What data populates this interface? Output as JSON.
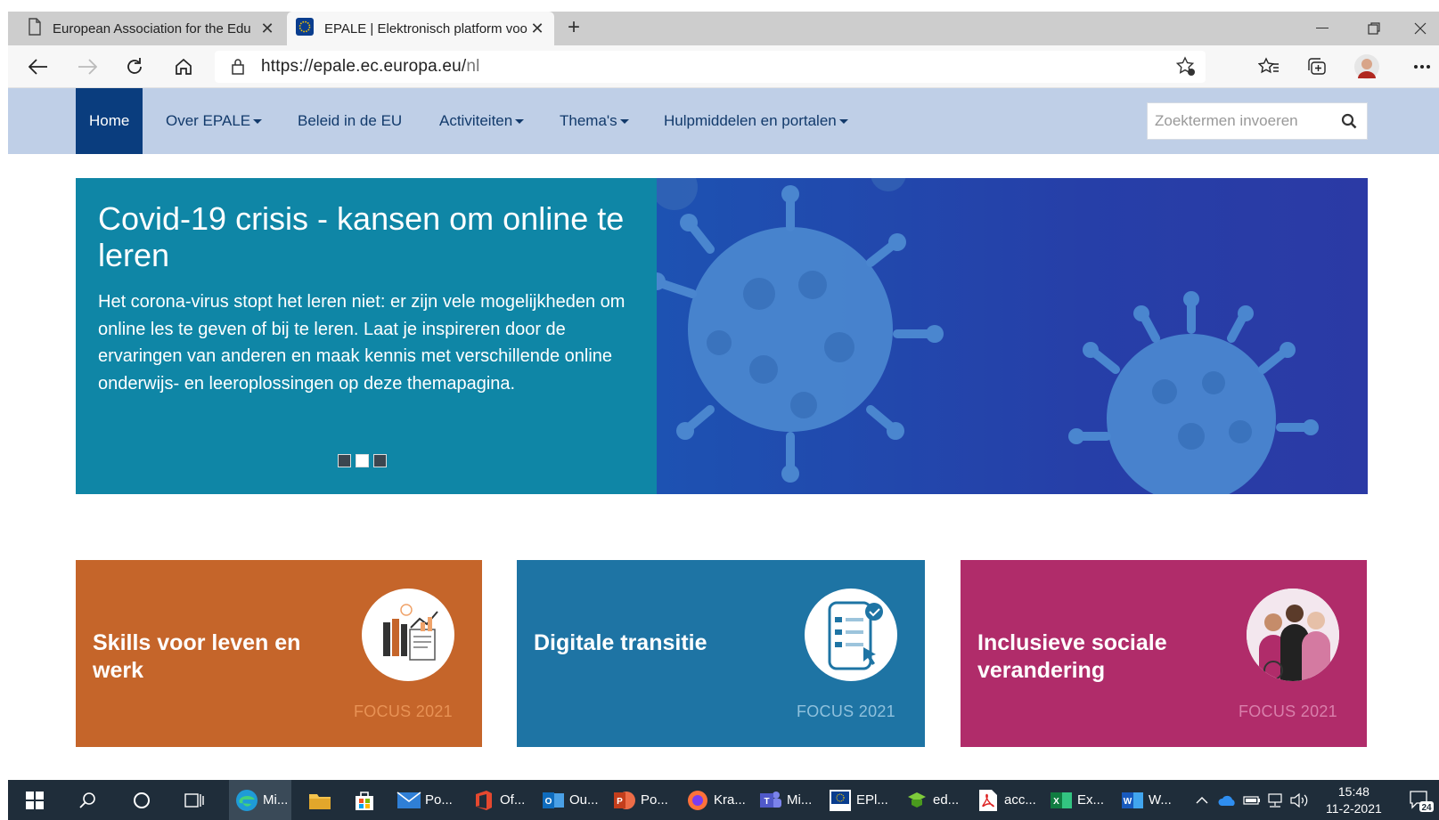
{
  "browser": {
    "tabs": [
      {
        "title": "European Association for the Edu",
        "close": "✕"
      },
      {
        "title": "EPALE | Elektronisch platform voo",
        "close": "✕"
      }
    ],
    "new_tab": "+",
    "url_host": "https://epale.ec.europa.eu/",
    "url_path": "nl",
    "window_controls": [
      "minimize",
      "restore",
      "close"
    ]
  },
  "site_nav": {
    "items": [
      "Home",
      "Over EPALE",
      "Beleid in de EU",
      "Activiteiten",
      "Thema's",
      "Hulpmiddelen en portalen"
    ],
    "search_placeholder": "Zoektermen invoeren"
  },
  "hero": {
    "title": "Covid-19 crisis - kansen om online te leren",
    "body": "Het corona-virus stopt het leren niet: er zijn vele mogelijkheden om online les te geven of bij te leren. Laat je inspireren door de ervaringen van anderen en maak kennis met verschillende online onderwijs- en leeroplossingen op deze themapagina.",
    "slides_total": 3,
    "active_slide": 2
  },
  "cards": [
    {
      "title": "Skills voor leven en werk",
      "focus": "FOCUS 2021",
      "color": "#c5652a",
      "icon": "books-chart-icon"
    },
    {
      "title": "Digitale transitie",
      "focus": "FOCUS 2021",
      "color": "#1e74a4",
      "icon": "phone-checklist-icon"
    },
    {
      "title": "Inclusieve sociale verandering",
      "focus": "FOCUS 2021",
      "color": "#b02c6a",
      "icon": "diverse-people-icon"
    }
  ],
  "taskbar": {
    "apps": [
      {
        "label": "Mi...",
        "icon": "edge-icon"
      },
      {
        "label": "",
        "icon": "file-explorer-icon"
      },
      {
        "label": "",
        "icon": "store-icon"
      },
      {
        "label": "Po...",
        "icon": "mail-icon"
      },
      {
        "label": "Of...",
        "icon": "office-icon"
      },
      {
        "label": "Ou...",
        "icon": "outlook-icon"
      },
      {
        "label": "Po...",
        "icon": "powerpoint-icon"
      },
      {
        "label": "Kra...",
        "icon": "firefox-icon"
      },
      {
        "label": "Mi...",
        "icon": "teams-icon"
      },
      {
        "label": "EPl...",
        "icon": "eplus-icon"
      },
      {
        "label": "ed...",
        "icon": "education-icon"
      },
      {
        "label": "acc...",
        "icon": "pdf-icon"
      },
      {
        "label": "Ex...",
        "icon": "excel-icon"
      },
      {
        "label": "W...",
        "icon": "word-icon"
      }
    ],
    "time": "15:48",
    "date": "11-2-2021",
    "notifications": "24"
  }
}
